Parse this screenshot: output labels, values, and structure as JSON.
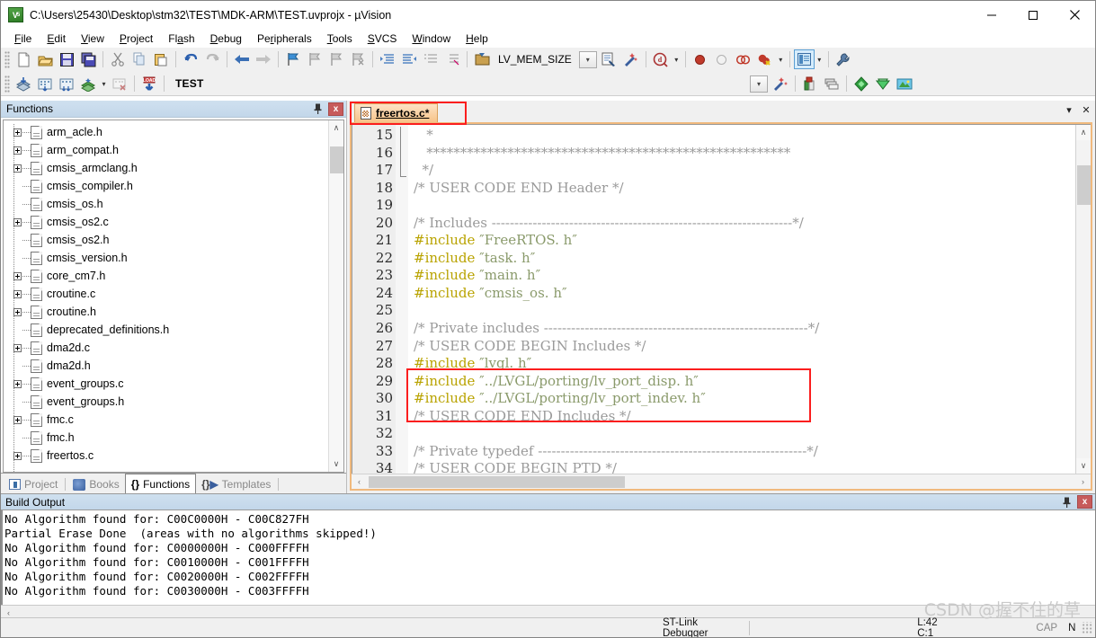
{
  "window": {
    "title": "C:\\Users\\25430\\Desktop\\stm32\\TEST\\MDK-ARM\\TEST.uvprojx - µVision",
    "app_icon": "uvision-icon",
    "minimize": "—",
    "maximize": "☐",
    "close": "✕"
  },
  "menu": {
    "items": [
      {
        "label": "File"
      },
      {
        "label": "Edit"
      },
      {
        "label": "View"
      },
      {
        "label": "Project"
      },
      {
        "label": "Flash"
      },
      {
        "label": "Debug"
      },
      {
        "label": "Peripherals"
      },
      {
        "label": "Tools"
      },
      {
        "label": "SVCS"
      },
      {
        "label": "Window"
      },
      {
        "label": "Help"
      }
    ]
  },
  "toolbar1": {
    "symbol_box_value": "LV_MEM_SIZE",
    "buttons": [
      "new-file-icon",
      "open-file-icon",
      "save-icon",
      "save-all-icon",
      "cut-icon",
      "copy-icon",
      "paste-icon",
      "undo-icon",
      "redo-icon",
      "navigate-back-icon",
      "navigate-forward-icon",
      "bookmark-toggle-icon",
      "bookmark-prev-icon",
      "bookmark-next-icon",
      "bookmark-clear-icon",
      "indent-icon",
      "outdent-icon",
      "comment-icon",
      "uncomment-icon",
      "find-in-files-icon"
    ],
    "right_buttons": [
      "symbol-dropdown-icon",
      "insert-snippet-icon",
      "configuration-wizard-icon",
      "start-debug-icon",
      "insert-breakpoint-icon",
      "disable-breakpoint-icon",
      "disable-all-breakpoints-icon",
      "kill-all-breakpoints-icon",
      "manage-windows-icon",
      "configure-target-icon"
    ]
  },
  "toolbar2": {
    "target_name": "TEST",
    "buttons": [
      "translate-icon",
      "build-icon",
      "rebuild-icon",
      "batch-build-icon",
      "batch-build-dropdown",
      "stop-build-icon",
      "download-icon"
    ],
    "right_buttons": [
      "target-options-icon",
      "manage-project-items-icon",
      "pack-installer-icon",
      "manage-runtime-icon",
      "svcs-icon"
    ]
  },
  "left_panel": {
    "caption": "Functions",
    "pin_icon": "pin-icon",
    "close_icon": "close-icon",
    "tree_items": [
      {
        "label": "arm_acle.h",
        "expandable": true
      },
      {
        "label": "arm_compat.h",
        "expandable": true
      },
      {
        "label": "cmsis_armclang.h",
        "expandable": true
      },
      {
        "label": "cmsis_compiler.h",
        "expandable": false
      },
      {
        "label": "cmsis_os.h",
        "expandable": false
      },
      {
        "label": "cmsis_os2.c",
        "expandable": true
      },
      {
        "label": "cmsis_os2.h",
        "expandable": false
      },
      {
        "label": "cmsis_version.h",
        "expandable": false
      },
      {
        "label": "core_cm7.h",
        "expandable": true
      },
      {
        "label": "croutine.c",
        "expandable": true
      },
      {
        "label": "croutine.h",
        "expandable": true
      },
      {
        "label": "deprecated_definitions.h",
        "expandable": false
      },
      {
        "label": "dma2d.c",
        "expandable": true
      },
      {
        "label": "dma2d.h",
        "expandable": false
      },
      {
        "label": "event_groups.c",
        "expandable": true
      },
      {
        "label": "event_groups.h",
        "expandable": false
      },
      {
        "label": "fmc.c",
        "expandable": true
      },
      {
        "label": "fmc.h",
        "expandable": false
      },
      {
        "label": "freertos.c",
        "expandable": true
      }
    ],
    "scroll_up": "∧",
    "scroll_down": "∨",
    "tabs": [
      {
        "label": "Project",
        "icon": "project-icon",
        "active": false
      },
      {
        "label": "Books",
        "icon": "books-icon",
        "active": false
      },
      {
        "label": "Functions",
        "icon": "braces-icon",
        "active": true
      },
      {
        "label": "Templates",
        "icon": "templates-icon",
        "active": false
      }
    ]
  },
  "editor": {
    "tab": {
      "label": "freertos.c*",
      "icon": "c-source-file-icon",
      "highlighted": true,
      "highlight_color": "#fb1e1e"
    },
    "tabstrip_buttons": [
      "window-list-dropdown-icon",
      "close-document-icon"
    ],
    "first_line_number": 15,
    "lines": [
      {
        "n": 15,
        "segments": [
          {
            "t": "   *",
            "c": "comment"
          }
        ]
      },
      {
        "n": 16,
        "segments": [
          {
            "t": "   ******************************************************",
            "c": "comment"
          }
        ]
      },
      {
        "n": 17,
        "segments": [
          {
            "t": "  */",
            "c": "comment"
          }
        ]
      },
      {
        "n": 18,
        "segments": [
          {
            "t": "/* USER CODE END Header */",
            "c": "comment"
          }
        ]
      },
      {
        "n": 19,
        "segments": [
          {
            "t": "",
            "c": "plain"
          }
        ]
      },
      {
        "n": 20,
        "segments": [
          {
            "t": "/* Includes ------------------------------------------------------------------*/",
            "c": "comment"
          }
        ]
      },
      {
        "n": 21,
        "segments": [
          {
            "t": "#include ",
            "c": "pre"
          },
          {
            "t": "″FreeRTOS. h″",
            "c": "str"
          }
        ]
      },
      {
        "n": 22,
        "segments": [
          {
            "t": "#include ",
            "c": "pre"
          },
          {
            "t": "″task. h″",
            "c": "str"
          }
        ]
      },
      {
        "n": 23,
        "segments": [
          {
            "t": "#include ",
            "c": "pre"
          },
          {
            "t": "″main. h″",
            "c": "str"
          }
        ]
      },
      {
        "n": 24,
        "segments": [
          {
            "t": "#include ",
            "c": "pre"
          },
          {
            "t": "″cmsis_os. h″",
            "c": "str"
          }
        ]
      },
      {
        "n": 25,
        "segments": [
          {
            "t": "",
            "c": "plain"
          }
        ]
      },
      {
        "n": 26,
        "segments": [
          {
            "t": "/* Private includes ----------------------------------------------------------*/",
            "c": "comment"
          }
        ]
      },
      {
        "n": 27,
        "segments": [
          {
            "t": "/* USER CODE BEGIN Includes */",
            "c": "comment"
          }
        ]
      },
      {
        "n": 28,
        "segments": [
          {
            "t": "#include ",
            "c": "pre"
          },
          {
            "t": "″lvgl. h″",
            "c": "str"
          }
        ]
      },
      {
        "n": 29,
        "segments": [
          {
            "t": "#include ",
            "c": "pre"
          },
          {
            "t": "″../LVGL/porting/lv_port_disp. h″",
            "c": "str"
          }
        ]
      },
      {
        "n": 30,
        "segments": [
          {
            "t": "#include ",
            "c": "pre"
          },
          {
            "t": "″../LVGL/porting/lv_port_indev. h″",
            "c": "str"
          }
        ]
      },
      {
        "n": 31,
        "segments": [
          {
            "t": "/* USER CODE END Includes */",
            "c": "comment"
          }
        ]
      },
      {
        "n": 32,
        "segments": [
          {
            "t": "",
            "c": "plain"
          }
        ]
      },
      {
        "n": 33,
        "segments": [
          {
            "t": "/* Private typedef -----------------------------------------------------------*/",
            "c": "comment"
          }
        ]
      },
      {
        "n": 34,
        "segments": [
          {
            "t": "/* USER CODE BEGIN PTD */",
            "c": "comment"
          }
        ]
      },
      {
        "n": 35,
        "segments": [
          {
            "t": "",
            "c": "plain"
          }
        ]
      }
    ],
    "highlight_note": "red box around lines 28-30",
    "scroll_left": "‹",
    "scroll_right": "›",
    "scroll_up": "∧",
    "scroll_down": "∨"
  },
  "build_output": {
    "caption": "Build Output",
    "pin_icon": "pin-icon",
    "close_icon": "close-icon",
    "lines": [
      "No Algorithm found for: C00C0000H - C00C827FH",
      "Partial Erase Done  (areas with no algorithms skipped!)",
      "No Algorithm found for: C0000000H - C000FFFFH",
      "No Algorithm found for: C0010000H - C001FFFFH",
      "No Algorithm found for: C0020000H - C002FFFFH",
      "No Algorithm found for: C0030000H - C003FFFFH"
    ],
    "scroll_left": "‹"
  },
  "statusbar": {
    "debugger": "ST-Link Debugger",
    "cursor": "L:42 C:1",
    "caps": "CAP",
    "num": "N"
  },
  "watermark": "CSDN @握不住的草",
  "colors": {
    "accent_tab": "#f7c389",
    "highlight_red": "#fb1e1e",
    "caption_blue": "#c3d7ea",
    "comment": "#9a9a9a",
    "preprocessor": "#b9a300",
    "string": "#8a9a6b"
  }
}
